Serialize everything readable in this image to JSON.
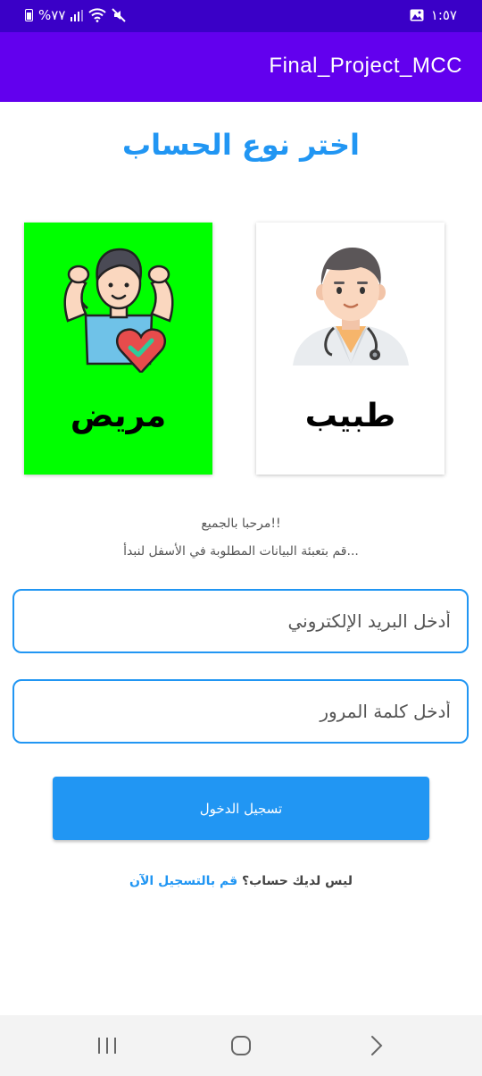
{
  "status_bar": {
    "time": "١:٥٧",
    "battery_text": "%٧٧"
  },
  "app_bar": {
    "title": "Final_Project_MCC"
  },
  "heading": "اختر نوع الحساب",
  "cards": {
    "doctor": {
      "label": "طبيب",
      "bg": "#ffffff"
    },
    "patient": {
      "label": "مريض",
      "bg": "#00ff00"
    }
  },
  "welcome": "مرحبا بالجميع!!",
  "instruction": "قم بتعبئة البيانات المطلوبة في الأسفل لنبدأ...",
  "form": {
    "email_placeholder": "أدخل البريد الإلكتروني",
    "email_value": "",
    "password_placeholder": "أدخل كلمة المرور",
    "password_value": "",
    "login_label": "تسجيل الدخول"
  },
  "register": {
    "question": "ليس لديك حساب؟",
    "link": "قم بالتسجيل الآن"
  },
  "colors": {
    "status_bar": "#3a00c7",
    "app_bar": "#6200ee",
    "accent": "#2196f3",
    "patient_card": "#00ff00"
  },
  "nav_icons": [
    "recent-apps-icon",
    "home-icon",
    "back-icon"
  ]
}
